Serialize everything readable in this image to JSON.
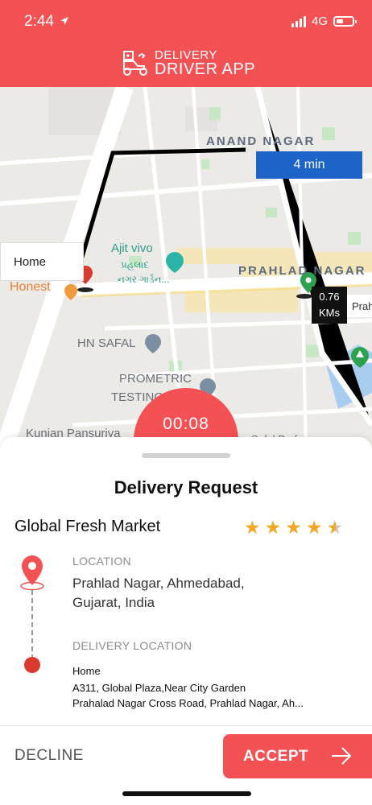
{
  "status_bar": {
    "time": "2:44",
    "network": "4G",
    "icons": [
      "location-arrow-icon",
      "signal-icon",
      "battery-icon"
    ]
  },
  "header": {
    "logo_line1": "DELIVERY",
    "logo_line2": "DRIVER APP",
    "logo_icon": "delivery-scooter-icon"
  },
  "map": {
    "route_time": "4 min",
    "origin_label": "Home",
    "distance_value": "0.76",
    "distance_unit": "KMs",
    "timer": "00:08",
    "callout_clip": "Prah",
    "labels": {
      "anand_nagar": "ANAND NAGAR",
      "prahlad_nagar": "PRAHLAD NAGAR",
      "ajit_vivo": "Ajit vivo",
      "ajit_gujarati_1": "પ્રહલાદ",
      "ajit_gujarati_2": "નગર ગાર્ડન...",
      "honest": "Honest",
      "hn_safal": "HN SAFAL",
      "prometric": "PROMETRIC",
      "testing": "TESTING",
      "kunjan": "Kunjan Pansuriya",
      "safal": "Safal Prof..."
    }
  },
  "request": {
    "title": "Delivery Request",
    "store_name": "Global Fresh Market",
    "rating": 4.5,
    "location_label": "LOCATION",
    "location_line1": "Prahlad Nagar, Ahmedabad,",
    "location_line2": "Gujarat, India",
    "delivery_label": "DELIVERY LOCATION",
    "delivery_name": "Home",
    "delivery_addr1": "A311, Global Plaza,Near City Garden",
    "delivery_addr2": "Prahalad Nagar Cross Road,  Prahlad Nagar,  Ah..."
  },
  "actions": {
    "decline": "DECLINE",
    "accept": "ACCEPT"
  },
  "colors": {
    "primary": "#f45155",
    "route_blue": "#1e63c7",
    "star": "#f5a623"
  }
}
